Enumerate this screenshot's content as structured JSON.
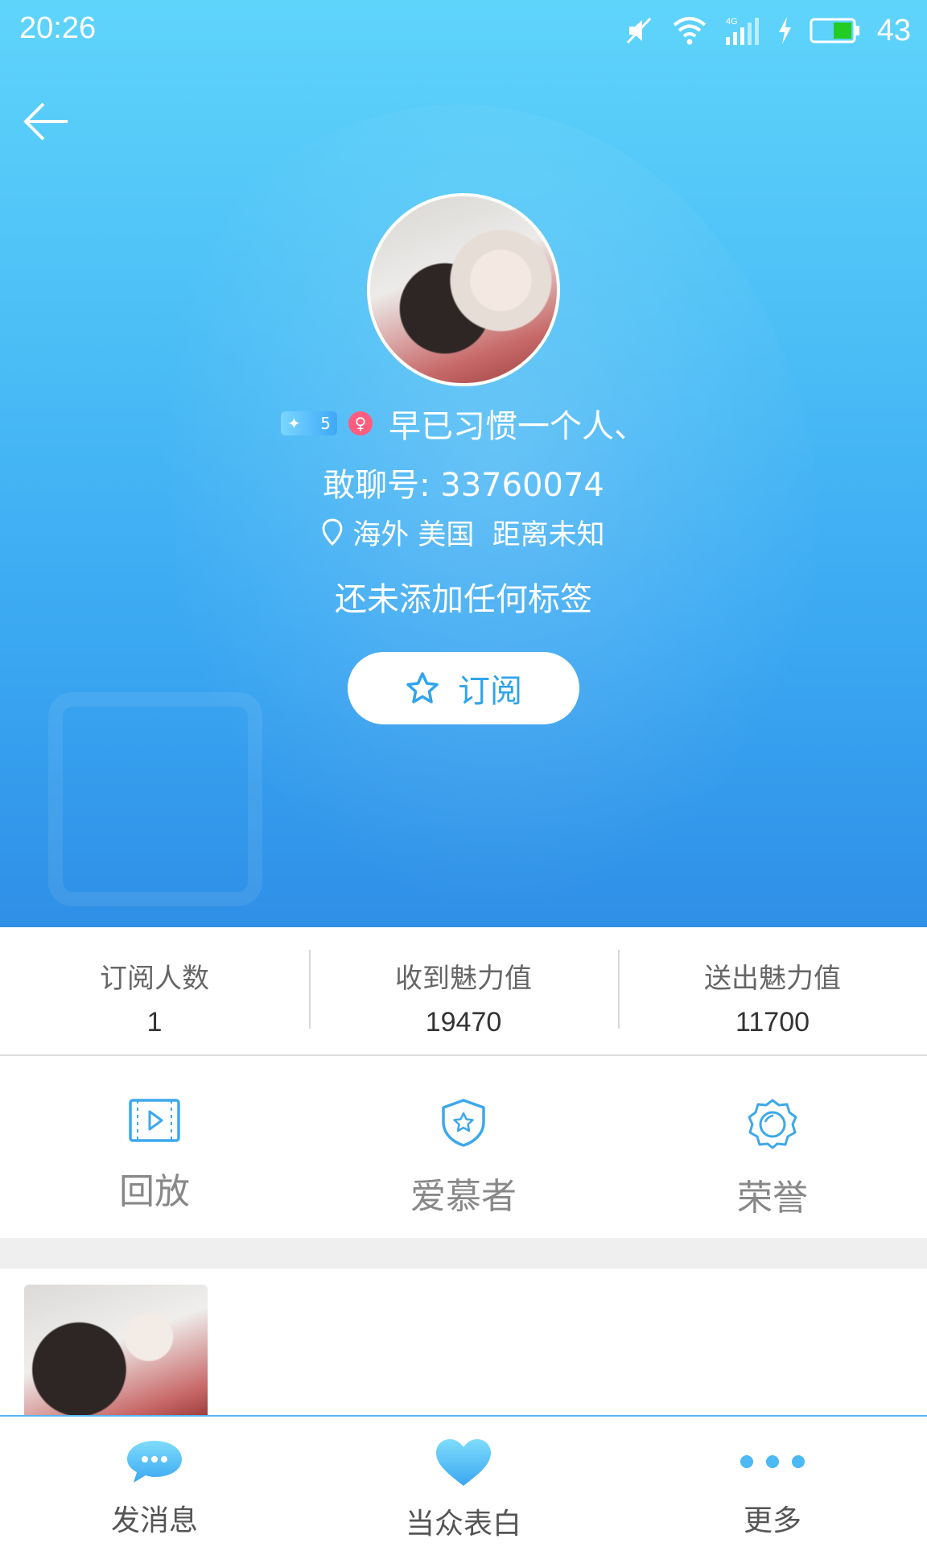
{
  "status_bar": {
    "time": "20:26",
    "battery_percent": "43",
    "icons": [
      "mute-icon",
      "wifi-icon",
      "signal-4g-icon",
      "charging-icon",
      "battery-icon"
    ]
  },
  "profile": {
    "level": "5",
    "nickname": "早已习惯一个人、",
    "user_id": "敢聊号: 33760074",
    "location": "海外 美国  距离未知",
    "tags_text": "还未添加任何标签",
    "subscribe_label": "订阅"
  },
  "stats": [
    {
      "label": "订阅人数",
      "value": "1"
    },
    {
      "label": "收到魅力值",
      "value": "19470"
    },
    {
      "label": "送出魅力值",
      "value": "11700"
    }
  ],
  "features": [
    {
      "label": "回放",
      "icon": "playback-icon"
    },
    {
      "label": "爱慕者",
      "icon": "admirer-shield-icon"
    },
    {
      "label": "荣誉",
      "icon": "honor-badge-icon"
    }
  ],
  "tab_bar": [
    {
      "label": "发消息",
      "icon": "message-bubble-icon"
    },
    {
      "label": "当众表白",
      "icon": "heart-icon"
    },
    {
      "label": "更多",
      "icon": "more-dots-icon"
    }
  ],
  "colors": {
    "accent": "#3aa7f2",
    "hero_top": "#5fd4fb",
    "hero_bottom": "#2f8fe6",
    "icon_blue": "#3da8ec",
    "female_badge": "#ff5c7e"
  }
}
